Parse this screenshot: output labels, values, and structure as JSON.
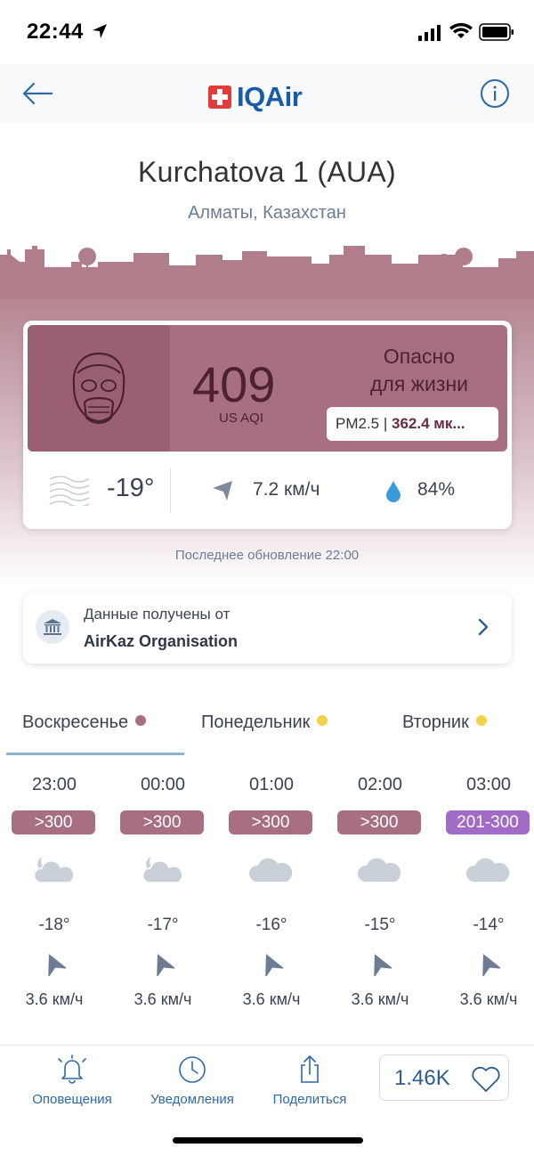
{
  "status_bar": {
    "time": "22:44"
  },
  "nav": {
    "logo_text": "IQAir"
  },
  "station": {
    "name": "Kurchatova 1 (AUA)",
    "city": "Алматы, Казахстан"
  },
  "aqi": {
    "value": "409",
    "unit": "US AQI",
    "level_line1": "Опасно",
    "level_line2": "для жизни",
    "pollutant": "PM2.5",
    "pollutant_sep": " | ",
    "pollutant_value": "362.4 мк...",
    "color": "#a86f82"
  },
  "weather": {
    "temperature": "-19°",
    "wind": "7.2 км/ч",
    "humidity": "84%"
  },
  "updated": "Последнее обновление 22:00",
  "source": {
    "label": "Данные получены от",
    "name": "AirKaz Organisation"
  },
  "tabs": [
    {
      "label": "Воскресенье",
      "dot_color": "#a86f82",
      "active": true
    },
    {
      "label": "Понедельник",
      "dot_color": "#f3d24a",
      "active": false
    },
    {
      "label": "Вторник",
      "dot_color": "#f3d24a",
      "active": false
    }
  ],
  "hourly": [
    {
      "time": "23:00",
      "aqi": ">300",
      "aqi_color": "#a86f82",
      "icon": "cloud-moon-icon",
      "temp": "-18°",
      "wind": "3.6 км/ч"
    },
    {
      "time": "00:00",
      "aqi": ">300",
      "aqi_color": "#a86f82",
      "icon": "cloud-moon-icon",
      "temp": "-17°",
      "wind": "3.6 км/ч"
    },
    {
      "time": "01:00",
      "aqi": ">300",
      "aqi_color": "#a86f82",
      "icon": "cloud-icon",
      "temp": "-16°",
      "wind": "3.6 км/ч"
    },
    {
      "time": "02:00",
      "aqi": ">300",
      "aqi_color": "#a86f82",
      "icon": "cloud-icon",
      "temp": "-15°",
      "wind": "3.6 км/ч"
    },
    {
      "time": "03:00",
      "aqi": "201-300",
      "aqi_color": "#a26bc6",
      "icon": "cloud-icon",
      "temp": "-14°",
      "wind": "3.6 км/ч"
    }
  ],
  "bottom_bar": {
    "alerts": "Оповещения",
    "notifications": "Уведомления",
    "share": "Поделиться",
    "likes": "1.46K"
  }
}
